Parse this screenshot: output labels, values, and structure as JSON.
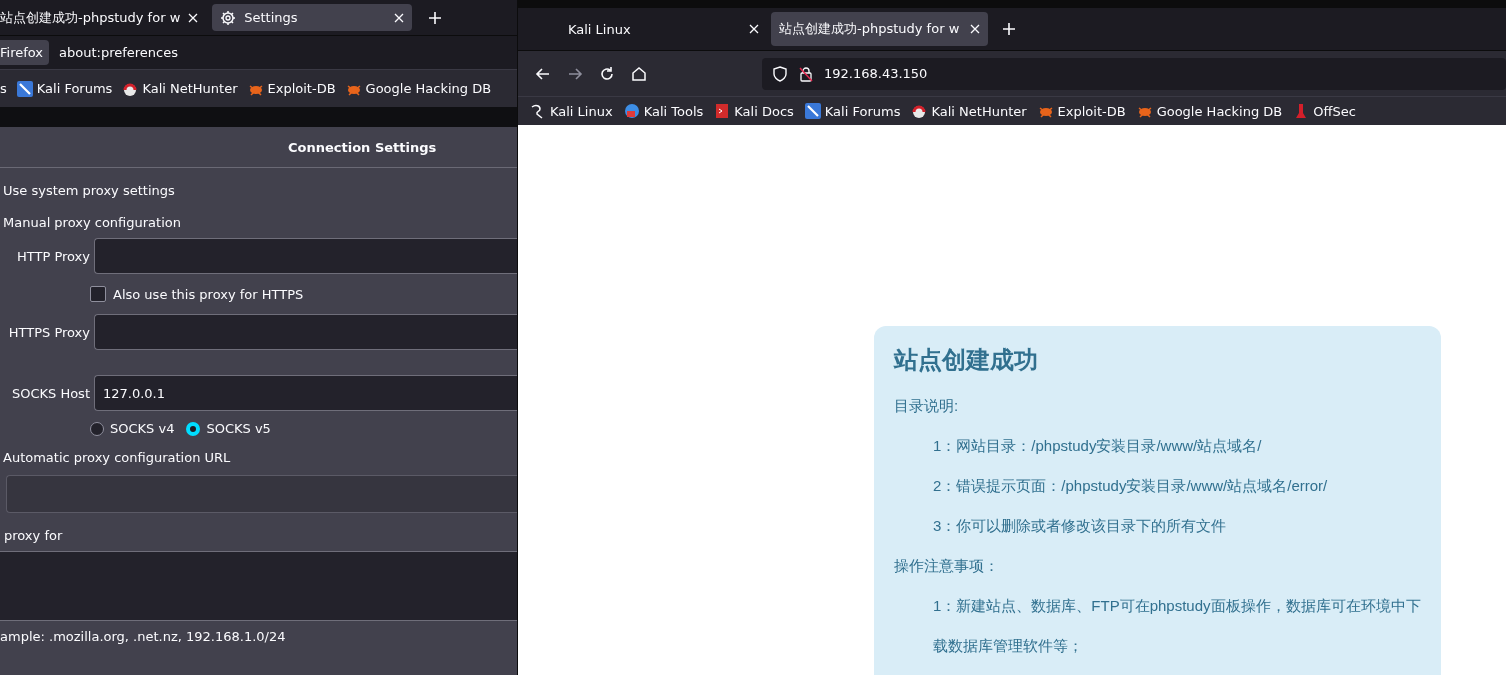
{
  "left_window": {
    "tabs": [
      {
        "title": "站点创建成功-phpstudy for w",
        "selected": false,
        "kind": "page"
      },
      {
        "title": "Settings",
        "selected": true,
        "kind": "settings"
      }
    ],
    "identity_label": "Firefox",
    "url": "about:preferences",
    "bookmarks": [
      {
        "title": "s",
        "kind": "none"
      },
      {
        "title": "Kali Forums",
        "kind": "forums"
      },
      {
        "title": "Kali NetHunter",
        "kind": "nethunter"
      },
      {
        "title": "Exploit-DB",
        "kind": "exploit"
      },
      {
        "title": "Google Hacking DB",
        "kind": "exploit"
      }
    ],
    "dialog": {
      "title": "Connection Settings",
      "system_proxy_label": "Use system proxy settings",
      "manual_label": "Manual proxy configuration",
      "http_proxy": {
        "label": "HTTP Proxy"
      },
      "also_https": {
        "label": "Also use this proxy for HTTPS",
        "checked": false
      },
      "https_proxy": {
        "label": "HTTPS Proxy"
      },
      "socks_host": {
        "label": "SOCKS Host",
        "value": "127.0.0.1"
      },
      "socks_versions": [
        {
          "label": "SOCKS v4",
          "selected": false
        },
        {
          "label": "SOCKS v5",
          "selected": true
        }
      ],
      "auto_label": "Automatic proxy configuration URL",
      "no_proxy_label": "proxy for",
      "no_proxy_hint": "ample: .mozilla.org, .net.nz, 192.168.1.0/24"
    }
  },
  "right_window": {
    "tabs": [
      {
        "title": "Kali Linux",
        "selected": false
      },
      {
        "title": "站点创建成功-phpstudy for w",
        "selected": true
      }
    ],
    "url": "192.168.43.150",
    "bookmarks": [
      {
        "title": "Kali Linux",
        "kind": "dragon"
      },
      {
        "title": "Kali Tools",
        "kind": "tools"
      },
      {
        "title": "Kali Docs",
        "kind": "docs"
      },
      {
        "title": "Kali Forums",
        "kind": "forums"
      },
      {
        "title": "Kali NetHunter",
        "kind": "nethunter"
      },
      {
        "title": "Exploit-DB",
        "kind": "exploit"
      },
      {
        "title": "Google Hacking DB",
        "kind": "exploit"
      },
      {
        "title": "OffSec",
        "kind": "offsec"
      }
    ],
    "page": {
      "title": "站点创建成功",
      "sections": [
        {
          "heading": "目录说明:",
          "items": [
            "1：网站目录：/phpstudy安装目录/www/站点域名/",
            "2：错误提示页面：/phpstudy安装目录/www/站点域名/error/",
            "3：你可以删除或者修改该目录下的所有文件"
          ]
        },
        {
          "heading": "操作注意事项：",
          "items": [
            "1：新建站点、数据库、FTP可在phpstudy面板操作，数据库可在环境中下载数据库管理软件等；"
          ]
        }
      ]
    }
  }
}
